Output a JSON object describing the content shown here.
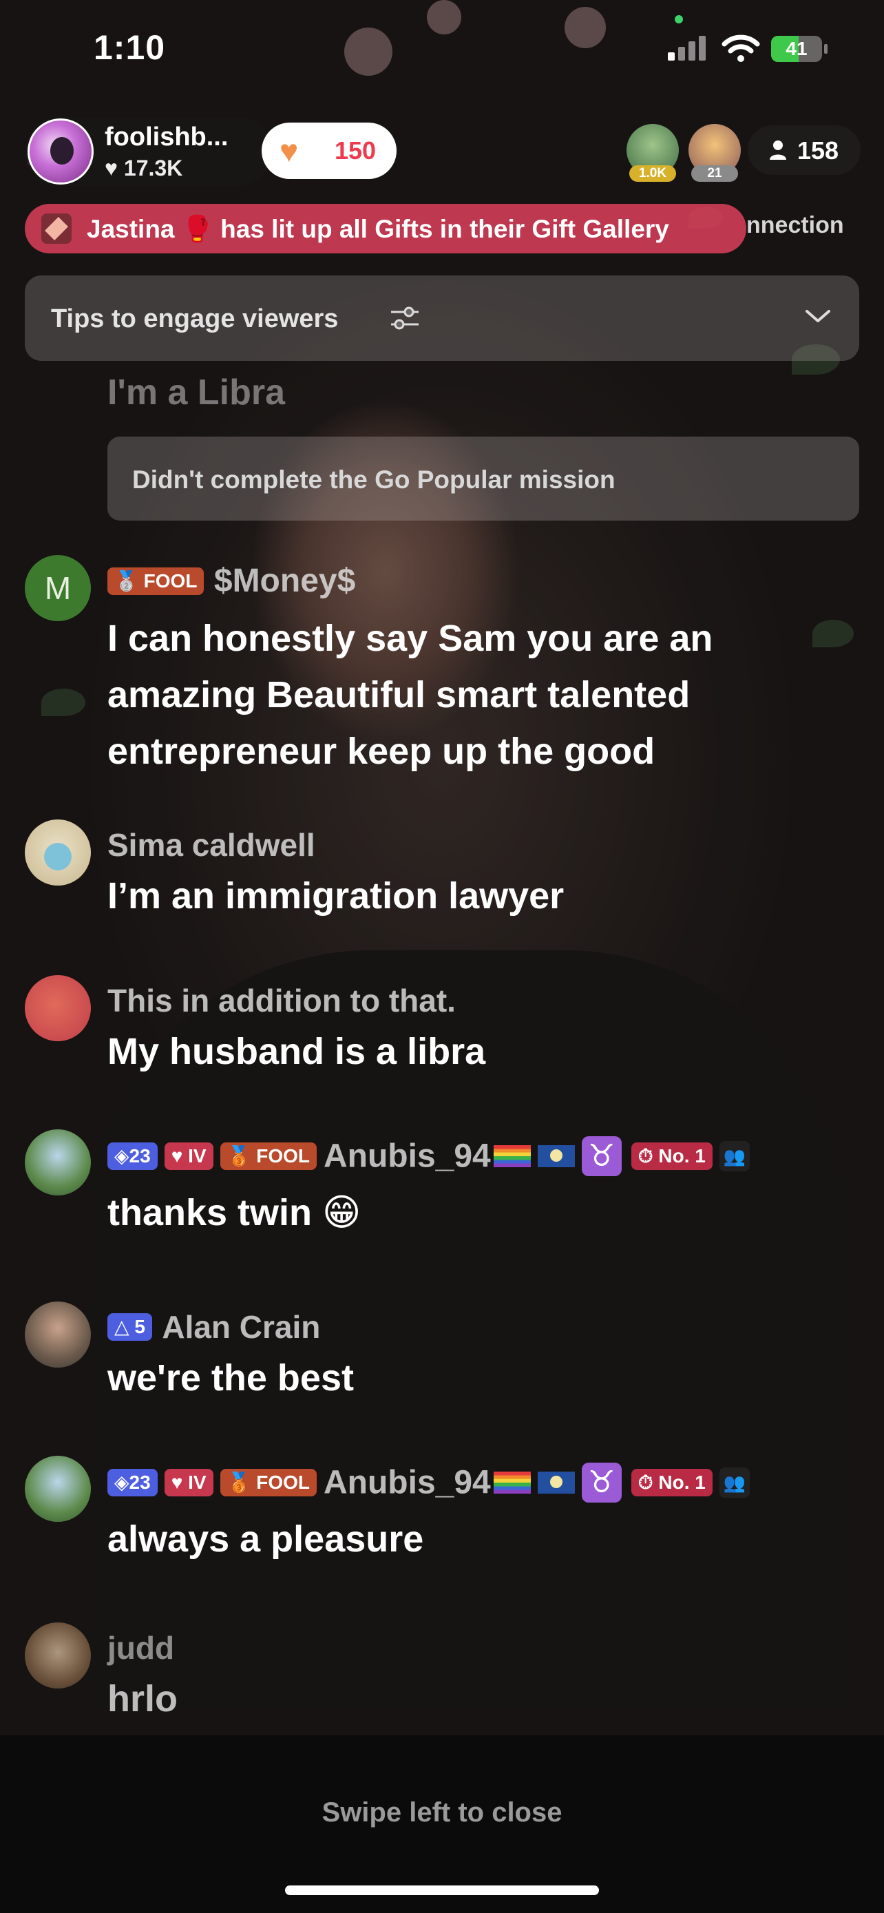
{
  "status_bar": {
    "time": "1:10",
    "battery": "41"
  },
  "host": {
    "name": "foolishb...",
    "likes": "17.3K"
  },
  "like_counter": "150",
  "top_viewers": [
    {
      "badge": "1.0K",
      "badge_color": "#d7b12a"
    },
    {
      "badge": "21",
      "badge_color": "#8a8a8a"
    }
  ],
  "viewer_count": "158",
  "gift_banner": {
    "text": "Jastina 🥊 has lit up all Gifts in their Gift Gallery",
    "behind_text": "nnection"
  },
  "tips": {
    "label": "Tips to engage viewers"
  },
  "faded_message": "I'm a Libra",
  "mission_card": {
    "text": "Didn't complete the Go Popular mission"
  },
  "messages": [
    {
      "user": "$Money$",
      "badges": [
        "FOOL"
      ],
      "text": "I can honestly say Sam you are an amazing Beautiful smart talented entrepreneur keep up the good",
      "avatar_letter": "M"
    },
    {
      "user": "Sima caldwell",
      "badges": [],
      "text": "I’m an immigration lawyer"
    },
    {
      "user": "This in addition to that.",
      "badges": [],
      "text": "My husband is a libra"
    },
    {
      "user": "Anubis_94",
      "badges": [
        "23",
        "IV",
        "FOOL",
        "No. 1"
      ],
      "text": "thanks twin 😁"
    },
    {
      "user": "Alan Crain",
      "badges": [
        "5"
      ],
      "text": "we're the best"
    },
    {
      "user": "Anubis_94",
      "badges": [
        "23",
        "IV",
        "FOOL",
        "No. 1"
      ],
      "text": "always a pleasure"
    },
    {
      "user": "judd",
      "badges": [],
      "text": "hrlo"
    }
  ],
  "zodiac_symbol": "♉",
  "footer": {
    "swipe_hint": "Swipe left to close"
  }
}
